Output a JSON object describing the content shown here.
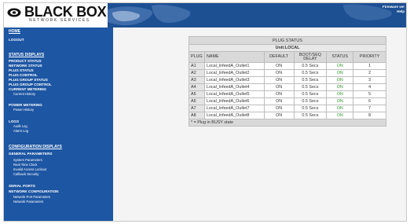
{
  "brand": {
    "name": "BLACK BOX",
    "tagline": "NETWORK SERVICES"
  },
  "header": {
    "banner_text_1": "Firmware ver",
    "banner_text_2": "Help"
  },
  "sidebar": {
    "items": [
      {
        "label": "HOME",
        "level": 0
      },
      {
        "label": "LOGOUT",
        "level": 1
      },
      {
        "label": "STATUS DISPLAYS",
        "level": 0
      },
      {
        "label": "PRODUCT STATUS",
        "level": 1
      },
      {
        "label": "NETWORK STATUS",
        "level": 1
      },
      {
        "label": "PLUG STATUS",
        "level": 1
      },
      {
        "label": "PLUG CONTROL",
        "level": 1
      },
      {
        "label": "PLUG GROUP STATUS",
        "level": 1
      },
      {
        "label": "PLUG GROUP CONTROL",
        "level": 1
      },
      {
        "label": "CURRENT METERING",
        "level": 1
      },
      {
        "label": "Current History",
        "level": 2
      },
      {
        "label": "POWER METERING",
        "level": 1
      },
      {
        "label": "Power History",
        "level": 2
      },
      {
        "label": "LOGS",
        "level": 1
      },
      {
        "label": "Audit Log",
        "level": 2
      },
      {
        "label": "Alarm Log",
        "level": 2
      },
      {
        "label": "CONFIGURATION DISPLAYS",
        "level": 0
      },
      {
        "label": "GENERAL PARAMETERS",
        "level": 1
      },
      {
        "label": "System Parameters",
        "level": 2
      },
      {
        "label": "Real Time Clock",
        "level": 2
      },
      {
        "label": "Invalid Access Lockout",
        "level": 2
      },
      {
        "label": "Callback Security",
        "level": 2
      },
      {
        "label": "SERIAL PORTS",
        "level": 1
      },
      {
        "label": "NETWORK CONFIGURATION",
        "level": 1
      },
      {
        "label": "Network Port Parameters",
        "level": 2
      },
      {
        "label": "Network Parameters",
        "level": 2
      }
    ]
  },
  "plug_status": {
    "title": "PLUG STATUS",
    "unit": "Unit:LOCAL",
    "columns": [
      "PLUG",
      "NAME",
      "DEFAULT",
      "BOOT/SEQ DELAY",
      "STATUS",
      "PRIORITY"
    ],
    "rows": [
      {
        "plug": "A1",
        "name": "Local_lnfeedA_Outlet1",
        "default": "ON",
        "delay": "0.5 Secs",
        "status": "ON",
        "priority": "1"
      },
      {
        "plug": "A2",
        "name": "Local_lnfeedA_Outlet2",
        "default": "ON",
        "delay": "0.5 Secs",
        "status": "ON",
        "priority": "2"
      },
      {
        "plug": "A3",
        "name": "Local_lnfeedA_Outlet3",
        "default": "ON",
        "delay": "0.5 Secs",
        "status": "ON",
        "priority": "3"
      },
      {
        "plug": "A4",
        "name": "Local_lnfeedA_Outlet4",
        "default": "ON",
        "delay": "0.5 Secs",
        "status": "ON",
        "priority": "4"
      },
      {
        "plug": "A5",
        "name": "Local_lnfeedA_Outlet5",
        "default": "ON",
        "delay": "0.5 Secs",
        "status": "ON",
        "priority": "5"
      },
      {
        "plug": "A6",
        "name": "Local_lnfeedA_Outlet6",
        "default": "ON",
        "delay": "0.5 Secs",
        "status": "ON",
        "priority": "6"
      },
      {
        "plug": "A7",
        "name": "Local_lnfeedA_Outlet7",
        "default": "ON",
        "delay": "0.5 Secs",
        "status": "ON",
        "priority": "7"
      },
      {
        "plug": "A8",
        "name": "Local_lnfeedA_Outlet8",
        "default": "ON",
        "delay": "0.5 Secs",
        "status": "ON",
        "priority": "8"
      }
    ],
    "note": "* = Plug in BUSY state"
  },
  "colors": {
    "sidebar_bg": "#1d56a3",
    "banner_bg": "#1d4f93",
    "status_on": "#2f9d2f",
    "header_cell_bg": "#d9d9d9"
  }
}
